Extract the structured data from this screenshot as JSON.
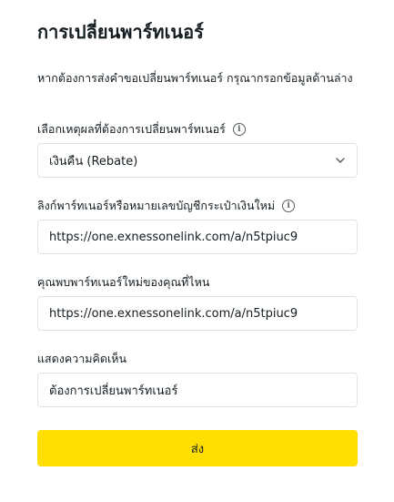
{
  "form": {
    "title": "การเปลี่ยนพาร์ทเนอร์",
    "intro": "หากต้องการส่งคำขอเปลี่ยนพาร์ทเนอร์ กรุณากรอกข้อมูลด้านล่าง",
    "reason": {
      "label": "เลือกเหตุผลที่ต้องการเปลี่ยนพาร์ทเนอร์",
      "selected": "เงินคืน (Rebate)"
    },
    "link": {
      "label": "ลิงก์พาร์ทเนอร์หรือหมายเลขบัญชีกระเป๋าเงินใหม่",
      "value": "https://one.exnessonelink.com/a/n5tpiuc9"
    },
    "where_found": {
      "label": "คุณพบพาร์ทเนอร์ใหม่ของคุณที่ไหน",
      "value": "https://one.exnessonelink.com/a/n5tpiuc9"
    },
    "comment": {
      "label": "แสดงความคิดเห็น",
      "value": "ต้องการเปลี่ยนพาร์ทเนอร์"
    },
    "submit_label": "ส่ง"
  },
  "icons": {
    "info": "info-icon",
    "dropdown": "chevron-down-icon"
  },
  "colors": {
    "accent": "#ffde02",
    "text": "#141d22",
    "border": "#dfe1e3"
  }
}
